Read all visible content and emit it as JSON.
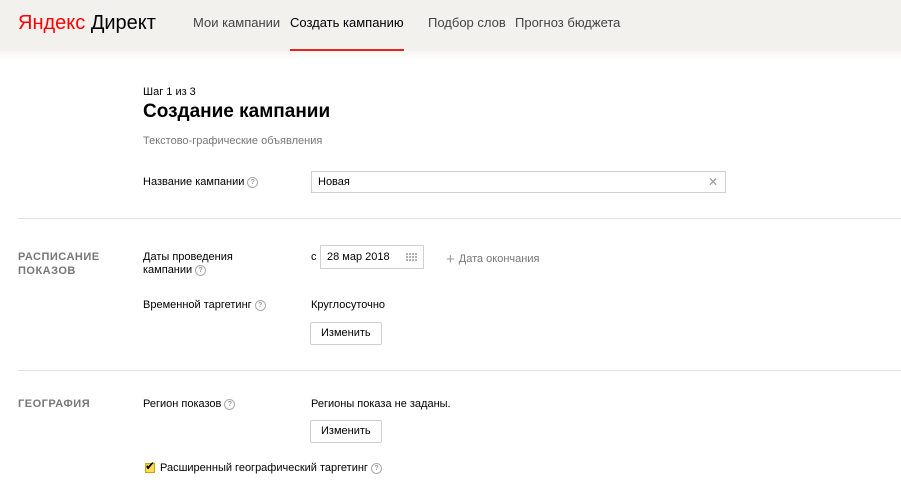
{
  "header": {
    "logo_brand": "Яндекс",
    "logo_product": "Директ",
    "nav": [
      {
        "label": "Мои кампании"
      },
      {
        "label": "Создать кампанию",
        "active": true
      },
      {
        "label": "Подбор слов"
      },
      {
        "label": "Прогноз бюджета"
      }
    ],
    "accent_color": "#e52320"
  },
  "form": {
    "step": "Шаг 1 из 3",
    "title": "Создание кампании",
    "subtitle": "Текстово-графические объявления",
    "campaign_name_label": "Название кампании",
    "campaign_name_value": "Новая",
    "schedule": {
      "section_title": "РАСПИСАНИЕ ПОКАЗОВ",
      "dates_label": "Даты проведения кампании",
      "dates_prefix": "с",
      "start_date": "28 мар 2018",
      "add_end_label": "Дата окончания",
      "time_targeting_label": "Временной таргетинг",
      "time_targeting_value": "Круглосуточно",
      "change_button": "Изменить"
    },
    "geo": {
      "section_title": "ГЕОГРАФИЯ",
      "region_label": "Регион показов",
      "region_value": "Регионы показа не заданы.",
      "change_button": "Изменить",
      "extended_geo_label": "Расширенный географический таргетинг",
      "extended_geo_checked": true
    }
  }
}
